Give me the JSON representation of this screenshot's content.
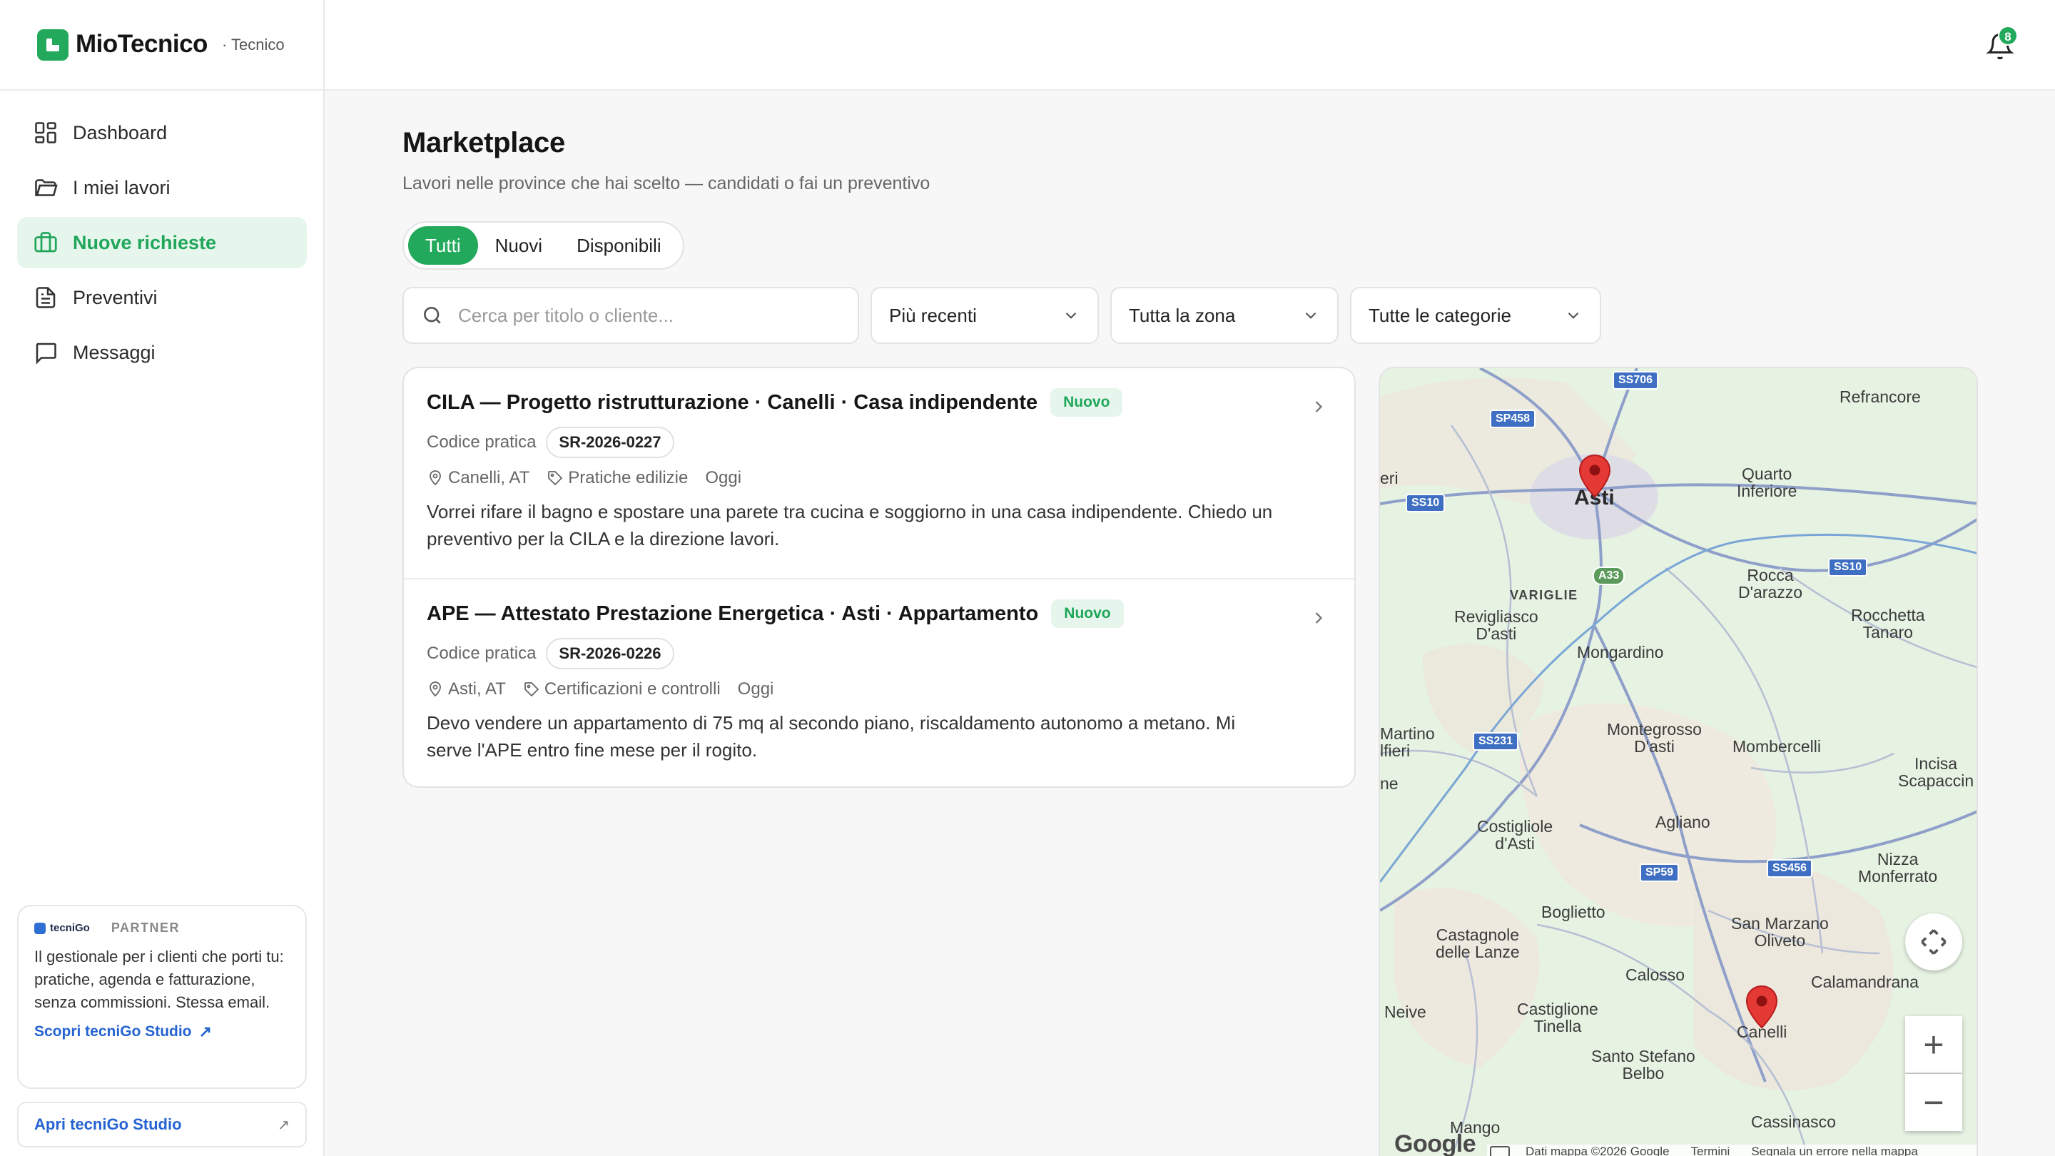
{
  "brand": {
    "name": "MioTecnico",
    "role": "· Tecnico"
  },
  "nav": [
    {
      "label": "Dashboard",
      "icon": "dashboard-icon"
    },
    {
      "label": "I miei lavori",
      "icon": "folder-icon"
    },
    {
      "label": "Nuove richieste",
      "icon": "briefcase-icon",
      "active": true
    },
    {
      "label": "Preventivi",
      "icon": "document-icon"
    },
    {
      "label": "Messaggi",
      "icon": "chat-icon"
    }
  ],
  "partner": {
    "logo_text": "tecniGo",
    "tag": "PARTNER",
    "text": "Il gestionale per i clienti che porti tu: pratiche, agenda e fatturazione, senza commissioni. Stessa email.",
    "link": "Scopri tecniGo Studio",
    "button": "Apri tecniGo Studio"
  },
  "notifications": {
    "count": "8"
  },
  "page": {
    "title": "Marketplace",
    "subtitle": "Lavori nelle province che hai scelto — candidati o fai un preventivo"
  },
  "tabs": [
    {
      "label": "Tutti",
      "active": true
    },
    {
      "label": "Nuovi"
    },
    {
      "label": "Disponibili"
    }
  ],
  "filters": {
    "search_placeholder": "Cerca per titolo o cliente...",
    "sort": "Più recenti",
    "zone": "Tutta la zona",
    "category": "Tutte le categorie"
  },
  "jobs": [
    {
      "title": "CILA — Progetto ristrutturazione · Canelli · Casa indipendente",
      "badge": "Nuovo",
      "code_label": "Codice pratica",
      "code": "SR-2026-0227",
      "location": "Canelli, AT",
      "category": "Pratiche edilizie",
      "date": "Oggi",
      "description": "Vorrei rifare il bagno e spostare una parete tra cucina e soggiorno in una casa indipendente. Chiedo un preventivo per la CILA e la direzione lavori."
    },
    {
      "title": "APE — Attestato Prestazione Energetica · Asti · Appartamento",
      "badge": "Nuovo",
      "code_label": "Codice pratica",
      "code": "SR-2026-0226",
      "location": "Asti, AT",
      "category": "Certificazioni e controlli",
      "date": "Oggi",
      "description": "Devo vendere un appartamento di 75 mq al secondo piano, riscaldamento autonomo a metano. Mi serve l'APE entro fine mese per il rogito."
    }
  ],
  "map": {
    "places": {
      "refrancore": "Refrancore",
      "quarto": "Quarto\nInferiore",
      "asti": "Asti",
      "eri": "eri",
      "variglie": "VARIGLIE",
      "rocca": "Rocca\nD'arazzo",
      "revigliasco": "Revigliasco\nD'asti",
      "rocchetta": "Rocchetta\nTanaro",
      "mongardino": "Mongardino",
      "martino": "Martino\nlfieri",
      "montegrosso": "Montegrosso\nD'asti",
      "mombercelli": "Mombercelli",
      "incisa": "Incisa\nScapaccin",
      "ne": "ne",
      "costigliole": "Costigliole\nd'Asti",
      "agliano": "Agliano",
      "nizza": "Nizza\nMonferrato",
      "boglietto": "Boglietto",
      "castagnole": "Castagnole\ndelle Lanze",
      "sanmarzano": "San Marzano\nOliveto",
      "calosso": "Calosso",
      "calamandrana": "Calamandrana",
      "neive": "Neive",
      "castiglione": "Castiglione\nTinella",
      "canelli": "Canelli",
      "santostefano": "Santo Stefano\nBelbo",
      "mango": "Mango",
      "cassinasco": "Cassinasco"
    },
    "roads": {
      "ss706": "SS706",
      "sp458": "SP458",
      "ss10a": "SS10",
      "ss10b": "SS10",
      "a33": "A33",
      "ss231": "SS231",
      "sp59": "SP59",
      "ss456": "SS456"
    },
    "google": "Google",
    "attribution": [
      "Dati mappa ©2026 Google",
      "Termini",
      "Segnala un errore nella mappa"
    ]
  }
}
